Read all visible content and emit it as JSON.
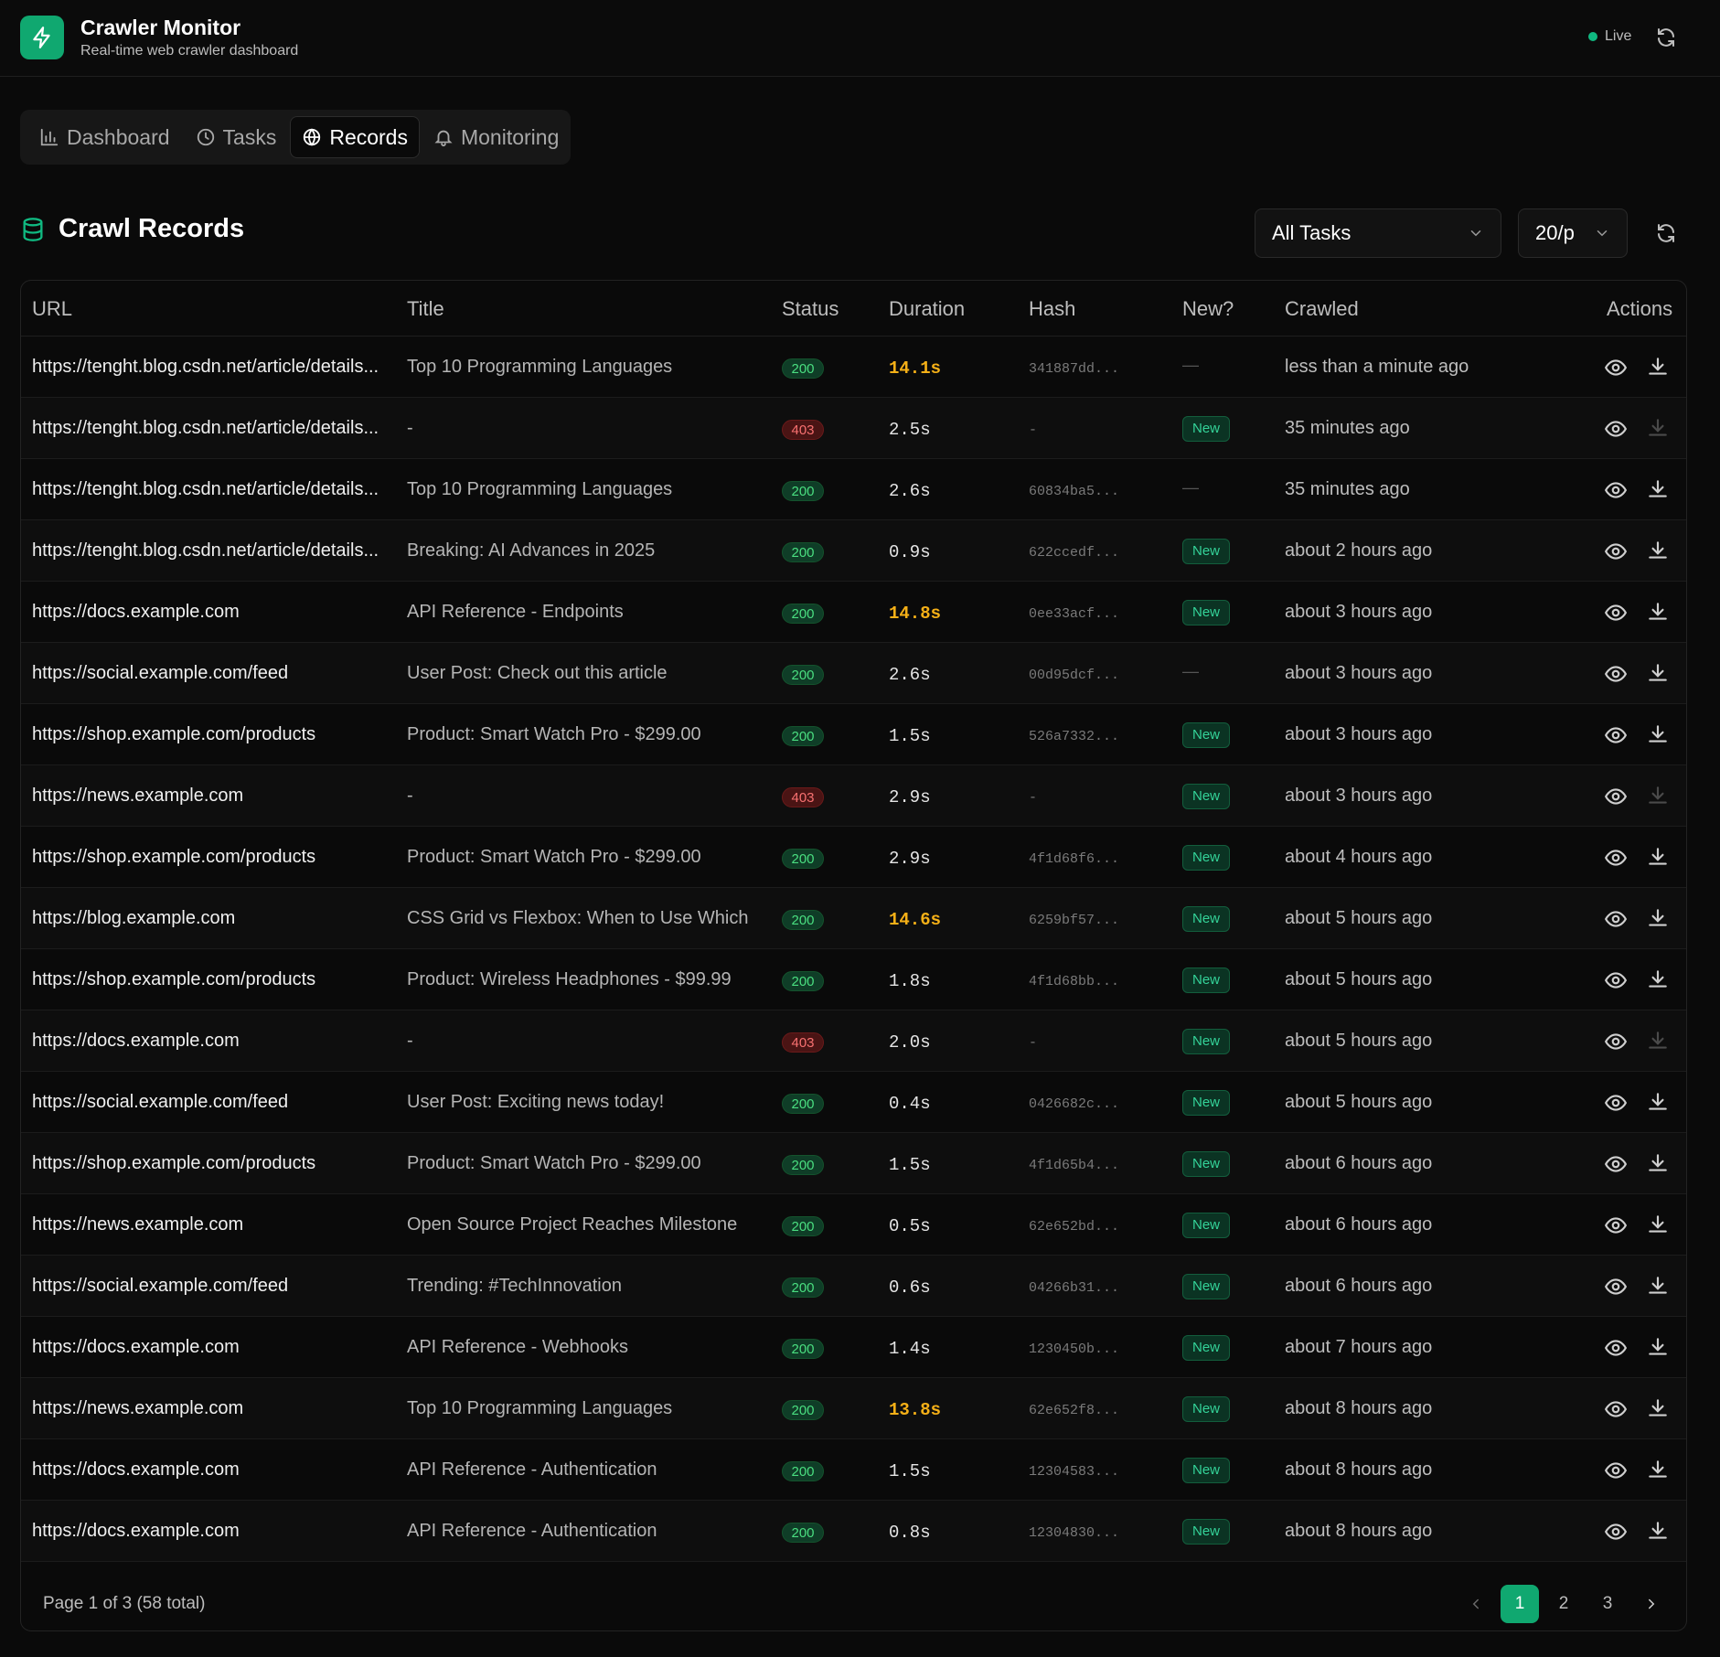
{
  "app": {
    "title": "Crawler Monitor",
    "subtitle": "Real-time web crawler dashboard",
    "live_label": "Live",
    "accent_color": "#10a870"
  },
  "nav": {
    "tabs": [
      {
        "label": "Dashboard",
        "icon": "bar-chart-icon",
        "active": false
      },
      {
        "label": "Tasks",
        "icon": "clock-icon",
        "active": false
      },
      {
        "label": "Records",
        "icon": "globe-icon",
        "active": true
      },
      {
        "label": "Monitoring",
        "icon": "bell-icon",
        "active": false
      }
    ]
  },
  "records": {
    "title": "Crawl Records",
    "task_filter": "All Tasks",
    "page_size": "20/p",
    "columns": [
      "URL",
      "Title",
      "Status",
      "Duration",
      "Hash",
      "New?",
      "Crawled",
      "Actions"
    ],
    "rows": [
      {
        "url": "https://tenght.blog.csdn.net/article/details...",
        "title": "Top 10 Programming Languages",
        "status": "200",
        "duration": "14.1s",
        "slow": true,
        "hash": "341887dd...",
        "new": "—",
        "crawled": "less than a minute ago",
        "download_enabled": true
      },
      {
        "url": "https://tenght.blog.csdn.net/article/details...",
        "title": "-",
        "status": "403",
        "duration": "2.5s",
        "slow": false,
        "hash": "-",
        "new": "New",
        "crawled": "35 minutes ago",
        "download_enabled": false
      },
      {
        "url": "https://tenght.blog.csdn.net/article/details...",
        "title": "Top 10 Programming Languages",
        "status": "200",
        "duration": "2.6s",
        "slow": false,
        "hash": "60834ba5...",
        "new": "—",
        "crawled": "35 minutes ago",
        "download_enabled": true
      },
      {
        "url": "https://tenght.blog.csdn.net/article/details...",
        "title": "Breaking: AI Advances in 2025",
        "status": "200",
        "duration": "0.9s",
        "slow": false,
        "hash": "622ccedf...",
        "new": "New",
        "crawled": "about 2 hours ago",
        "download_enabled": true
      },
      {
        "url": "https://docs.example.com",
        "title": "API Reference - Endpoints",
        "status": "200",
        "duration": "14.8s",
        "slow": true,
        "hash": "0ee33acf...",
        "new": "New",
        "crawled": "about 3 hours ago",
        "download_enabled": true
      },
      {
        "url": "https://social.example.com/feed",
        "title": "User Post: Check out this article",
        "status": "200",
        "duration": "2.6s",
        "slow": false,
        "hash": "00d95dcf...",
        "new": "—",
        "crawled": "about 3 hours ago",
        "download_enabled": true
      },
      {
        "url": "https://shop.example.com/products",
        "title": "Product: Smart Watch Pro - $299.00",
        "status": "200",
        "duration": "1.5s",
        "slow": false,
        "hash": "526a7332...",
        "new": "New",
        "crawled": "about 3 hours ago",
        "download_enabled": true
      },
      {
        "url": "https://news.example.com",
        "title": "-",
        "status": "403",
        "duration": "2.9s",
        "slow": false,
        "hash": "-",
        "new": "New",
        "crawled": "about 3 hours ago",
        "download_enabled": false
      },
      {
        "url": "https://shop.example.com/products",
        "title": "Product: Smart Watch Pro - $299.00",
        "status": "200",
        "duration": "2.9s",
        "slow": false,
        "hash": "4f1d68f6...",
        "new": "New",
        "crawled": "about 4 hours ago",
        "download_enabled": true
      },
      {
        "url": "https://blog.example.com",
        "title": "CSS Grid vs Flexbox: When to Use Which",
        "status": "200",
        "duration": "14.6s",
        "slow": true,
        "hash": "6259bf57...",
        "new": "New",
        "crawled": "about 5 hours ago",
        "download_enabled": true
      },
      {
        "url": "https://shop.example.com/products",
        "title": "Product: Wireless Headphones - $99.99",
        "status": "200",
        "duration": "1.8s",
        "slow": false,
        "hash": "4f1d68bb...",
        "new": "New",
        "crawled": "about 5 hours ago",
        "download_enabled": true
      },
      {
        "url": "https://docs.example.com",
        "title": "-",
        "status": "403",
        "duration": "2.0s",
        "slow": false,
        "hash": "-",
        "new": "New",
        "crawled": "about 5 hours ago",
        "download_enabled": false
      },
      {
        "url": "https://social.example.com/feed",
        "title": "User Post: Exciting news today!",
        "status": "200",
        "duration": "0.4s",
        "slow": false,
        "hash": "0426682c...",
        "new": "New",
        "crawled": "about 5 hours ago",
        "download_enabled": true
      },
      {
        "url": "https://shop.example.com/products",
        "title": "Product: Smart Watch Pro - $299.00",
        "status": "200",
        "duration": "1.5s",
        "slow": false,
        "hash": "4f1d65b4...",
        "new": "New",
        "crawled": "about 6 hours ago",
        "download_enabled": true
      },
      {
        "url": "https://news.example.com",
        "title": "Open Source Project Reaches Milestone",
        "status": "200",
        "duration": "0.5s",
        "slow": false,
        "hash": "62e652bd...",
        "new": "New",
        "crawled": "about 6 hours ago",
        "download_enabled": true
      },
      {
        "url": "https://social.example.com/feed",
        "title": "Trending: #TechInnovation",
        "status": "200",
        "duration": "0.6s",
        "slow": false,
        "hash": "04266b31...",
        "new": "New",
        "crawled": "about 6 hours ago",
        "download_enabled": true
      },
      {
        "url": "https://docs.example.com",
        "title": "API Reference - Webhooks",
        "status": "200",
        "duration": "1.4s",
        "slow": false,
        "hash": "1230450b...",
        "new": "New",
        "crawled": "about 7 hours ago",
        "download_enabled": true
      },
      {
        "url": "https://news.example.com",
        "title": "Top 10 Programming Languages",
        "status": "200",
        "duration": "13.8s",
        "slow": true,
        "hash": "62e652f8...",
        "new": "New",
        "crawled": "about 8 hours ago",
        "download_enabled": true
      },
      {
        "url": "https://docs.example.com",
        "title": "API Reference - Authentication",
        "status": "200",
        "duration": "1.5s",
        "slow": false,
        "hash": "12304583...",
        "new": "New",
        "crawled": "about 8 hours ago",
        "download_enabled": true
      },
      {
        "url": "https://docs.example.com",
        "title": "API Reference - Authentication",
        "status": "200",
        "duration": "0.8s",
        "slow": false,
        "hash": "12304830...",
        "new": "New",
        "crawled": "about 8 hours ago",
        "download_enabled": true
      }
    ]
  },
  "pagination": {
    "info": "Page 1 of 3 (58 total)",
    "pages": [
      "1",
      "2",
      "3"
    ],
    "current": "1"
  }
}
